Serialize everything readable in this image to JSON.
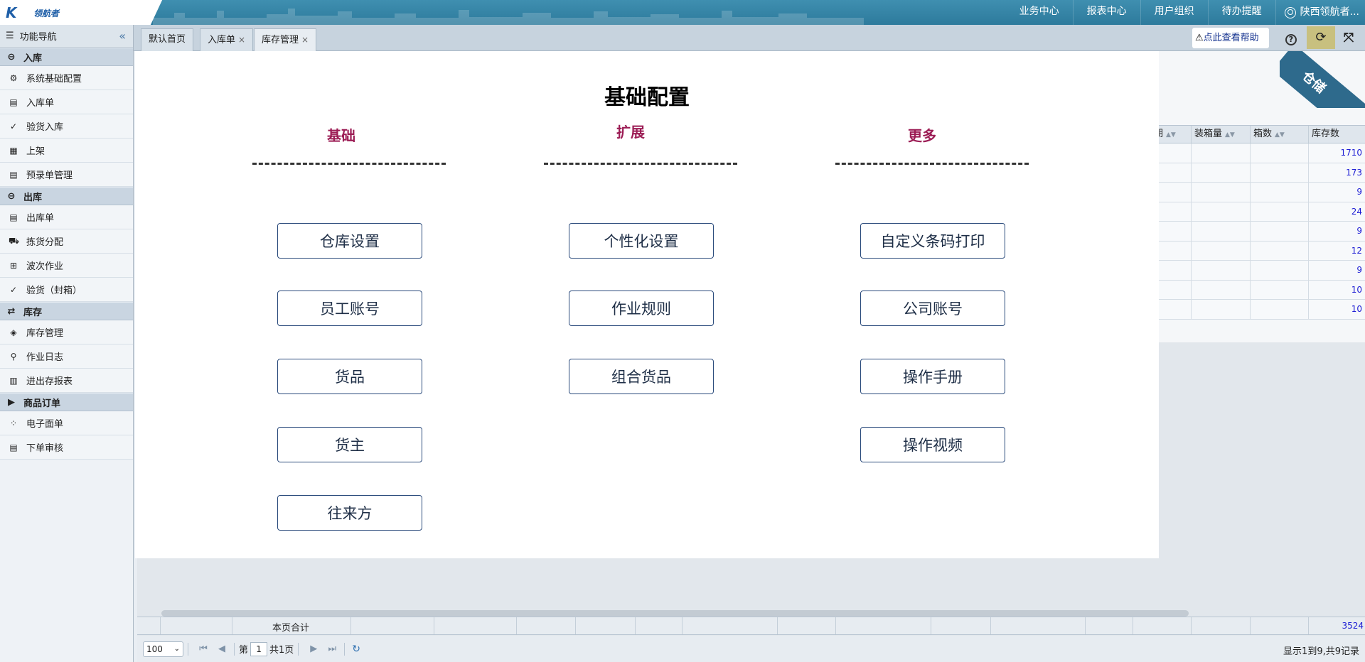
{
  "header": {
    "logo_text": "领航者",
    "nav": [
      "业务中心",
      "报表中心",
      "用户组织",
      "待办提醒"
    ],
    "user": "陕西领航者..."
  },
  "sidebar": {
    "title": "功能导航",
    "groups": [
      {
        "label": "入库",
        "items": [
          "系统基础配置",
          "入库单",
          "验货入库",
          "上架",
          "预录单管理"
        ]
      },
      {
        "label": "出库",
        "items": [
          "出库单",
          "拣货分配",
          "波次作业",
          "验货（封箱）"
        ]
      },
      {
        "label": "库存",
        "items": [
          "库存管理",
          "作业日志",
          "进出存报表"
        ]
      },
      {
        "label": "商品订单",
        "items": [
          "电子面单",
          "下单审核"
        ]
      }
    ]
  },
  "tabs": [
    {
      "label": "默认首页"
    },
    {
      "label": "入库单"
    },
    {
      "label": "库存管理"
    }
  ],
  "toolbar": {
    "help_label": "点此查看帮助"
  },
  "grid": {
    "columns": [
      "期日期",
      "装箱量",
      "箱数",
      "库存数"
    ],
    "stock_values": [
      "1710",
      "173",
      "9",
      "24",
      "9",
      "12",
      "9",
      "10",
      "10"
    ],
    "sum_label": "本页合计",
    "sum_total": "3524",
    "corner_badge": "仓储"
  },
  "pager": {
    "page_size": "100",
    "page_prefix": "第",
    "page_number": "1",
    "page_suffix": "共1页",
    "record_info": "显示1到9,共9记录"
  },
  "modal": {
    "title": "基础配置",
    "columns": [
      {
        "title": "基础",
        "buttons": [
          "仓库设置",
          "员工账号",
          "货品",
          "货主",
          "往来方"
        ]
      },
      {
        "title": "扩展",
        "buttons": [
          "个性化设置",
          "作业规则",
          "组合货品"
        ]
      },
      {
        "title": "更多",
        "buttons": [
          "自定义条码打印",
          "公司账号",
          "操作手册",
          "操作视频"
        ]
      }
    ]
  }
}
